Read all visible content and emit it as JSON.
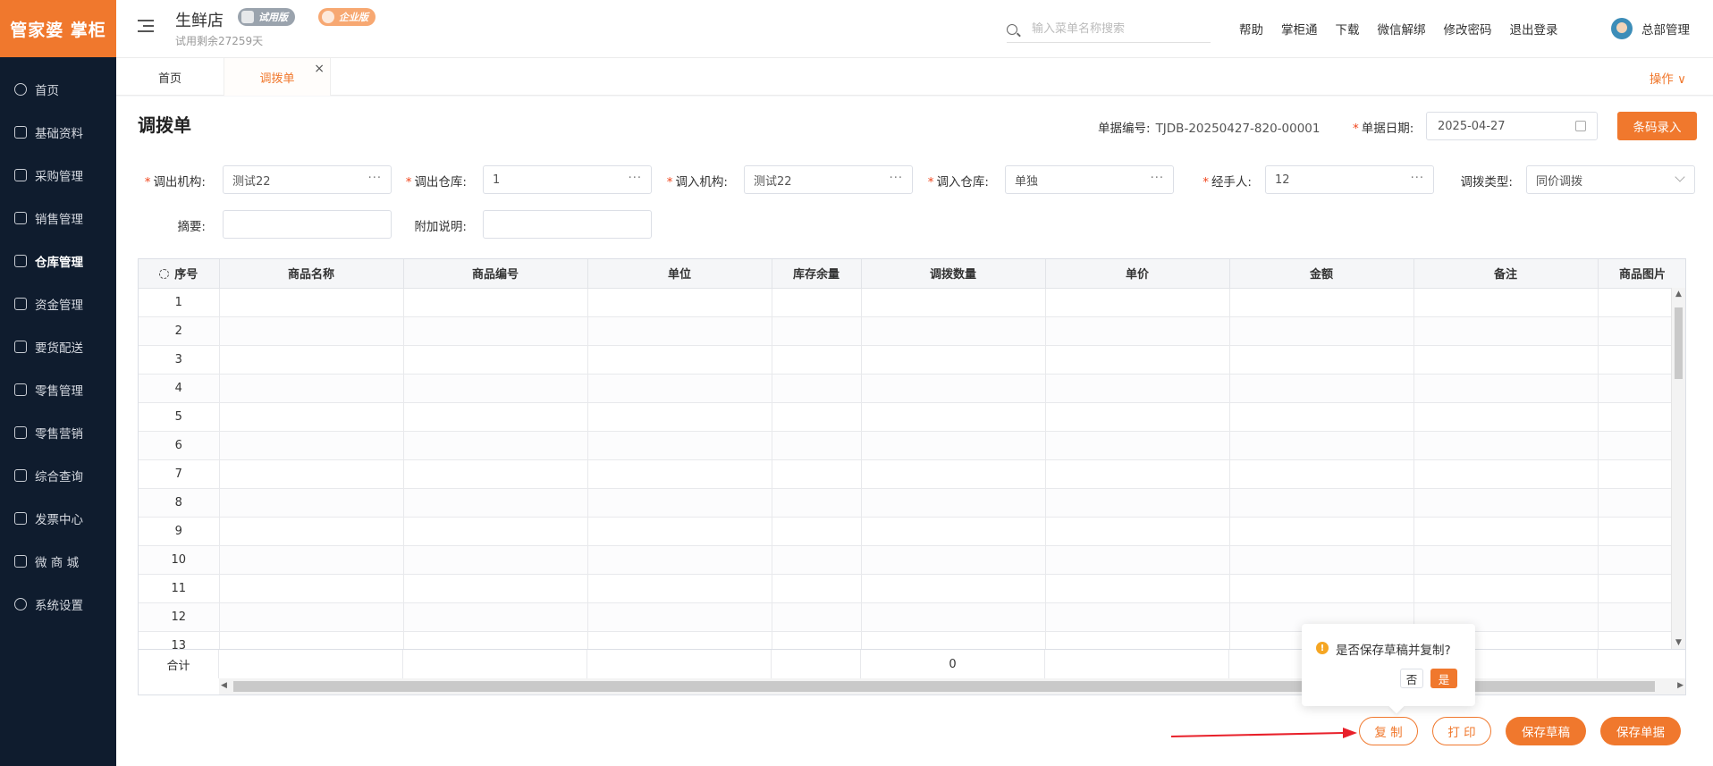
{
  "sidebar": {
    "logo": "管家婆 掌柜",
    "items": [
      {
        "label": "首页",
        "icon": "globe-icon"
      },
      {
        "label": "基础资料",
        "icon": "home-icon"
      },
      {
        "label": "采购管理",
        "icon": "cart-icon"
      },
      {
        "label": "销售管理",
        "icon": "sales-icon"
      },
      {
        "label": "仓库管理",
        "icon": "warehouse-icon"
      },
      {
        "label": "资金管理",
        "icon": "money-icon"
      },
      {
        "label": "要货配送",
        "icon": "delivery-icon"
      },
      {
        "label": "零售管理",
        "icon": "retail-icon"
      },
      {
        "label": "零售营销",
        "icon": "gift-icon"
      },
      {
        "label": "综合查询",
        "icon": "chart-icon"
      },
      {
        "label": "发票中心",
        "icon": "invoice-icon"
      },
      {
        "label": "微 商 城",
        "icon": "shop-icon"
      },
      {
        "label": "系统设置",
        "icon": "gear-icon"
      }
    ],
    "active_index": 4
  },
  "header": {
    "store_name": "生鲜店",
    "badge_trial": "试用版",
    "badge_enterprise": "企业版",
    "trial_remaining": "试用剩余27259天",
    "search_placeholder": "输入菜单名称搜索",
    "links": [
      "帮助",
      "掌柜通",
      "下载",
      "微信解绑",
      "修改密码",
      "退出登录"
    ],
    "user_name": "总部管理"
  },
  "tabs": {
    "home": "首页",
    "active": "调拨单",
    "close": "×",
    "ops": "操作 ∨"
  },
  "form": {
    "title": "调拨单",
    "doc_no_label": "单据编号:",
    "doc_no_value": "TJDB-20250427-820-00001",
    "date_label": "单据日期:",
    "date_value": "2025-04-27",
    "barcode_button": "条码录入",
    "out_org_label": "调出机构:",
    "out_org_value": "测试22",
    "out_wh_label": "调出仓库:",
    "out_wh_value": "1",
    "in_org_label": "调入机构:",
    "in_org_value": "测试22",
    "in_wh_label": "调入仓库:",
    "in_wh_value": "单独",
    "handler_label": "经手人:",
    "handler_value": "12",
    "type_label": "调拨类型:",
    "type_value": "同价调拨",
    "summary_label": "摘要:",
    "summary_value": "",
    "note_label": "附加说明:",
    "note_value": "",
    "dots": "···"
  },
  "table": {
    "headers": [
      "序号",
      "商品名称",
      "商品编号",
      "单位",
      "库存余量",
      "调拨数量",
      "单价",
      "金额",
      "备注",
      "商品图片"
    ],
    "rows": [
      "1",
      "2",
      "3",
      "4",
      "5",
      "6",
      "7",
      "8",
      "9",
      "10",
      "11",
      "12",
      "13"
    ],
    "total_label": "合计",
    "total_qty": "0"
  },
  "actions": {
    "copy": "复 制",
    "print": "打 印",
    "save_draft": "保存草稿",
    "save_doc": "保存单据"
  },
  "popconfirm": {
    "text": "是否保存草稿并复制?",
    "no": "否",
    "yes": "是",
    "warn": "!"
  },
  "colors": {
    "accent": "#f0782d",
    "sidebar_bg": "#0f1c2e",
    "annotation_arrow": "#e8202a"
  }
}
